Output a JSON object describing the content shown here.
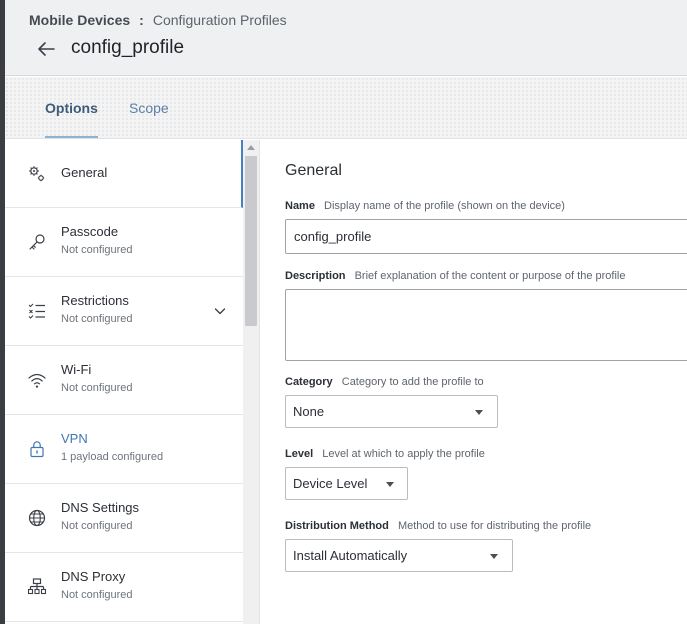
{
  "header": {
    "breadcrumb_parent": "Mobile Devices",
    "breadcrumb_separator": ":",
    "breadcrumb_current": "Configuration Profiles",
    "title": "config_profile"
  },
  "tabs": [
    {
      "label": "Options",
      "selected": true
    },
    {
      "label": "Scope",
      "selected": false
    }
  ],
  "sidebar": {
    "items": [
      {
        "label": "General",
        "sub": "",
        "icon": "gear-icon",
        "active": true
      },
      {
        "label": "Passcode",
        "sub": "Not configured",
        "icon": "key-icon"
      },
      {
        "label": "Restrictions",
        "sub": "Not configured",
        "icon": "checklist-icon",
        "expandable": true
      },
      {
        "label": "Wi-Fi",
        "sub": "Not configured",
        "icon": "wifi-icon"
      },
      {
        "label": "VPN",
        "sub": "1 payload configured",
        "icon": "lock-icon"
      },
      {
        "label": "DNS Settings",
        "sub": "Not configured",
        "icon": "globe-icon"
      },
      {
        "label": "DNS Proxy",
        "sub": "Not configured",
        "icon": "network-icon"
      }
    ]
  },
  "main": {
    "section_title": "General",
    "name": {
      "label": "Name",
      "hint": "Display name of the profile (shown on the device)",
      "value": "config_profile"
    },
    "description": {
      "label": "Description",
      "hint": "Brief explanation of the content or purpose of the profile",
      "value": ""
    },
    "category": {
      "label": "Category",
      "hint": "Category to add the profile to",
      "value": "None"
    },
    "level": {
      "label": "Level",
      "hint": "Level at which to apply the profile",
      "value": "Device Level"
    },
    "distribution": {
      "label": "Distribution Method",
      "hint": "Method to use for distributing the profile",
      "value": "Install Automatically"
    }
  },
  "colors": {
    "accent": "#4a7fc1",
    "vpn_label": "#3f76b8",
    "tab_active": "#3e5b77",
    "tab_inactive": "#5b7fa6"
  }
}
